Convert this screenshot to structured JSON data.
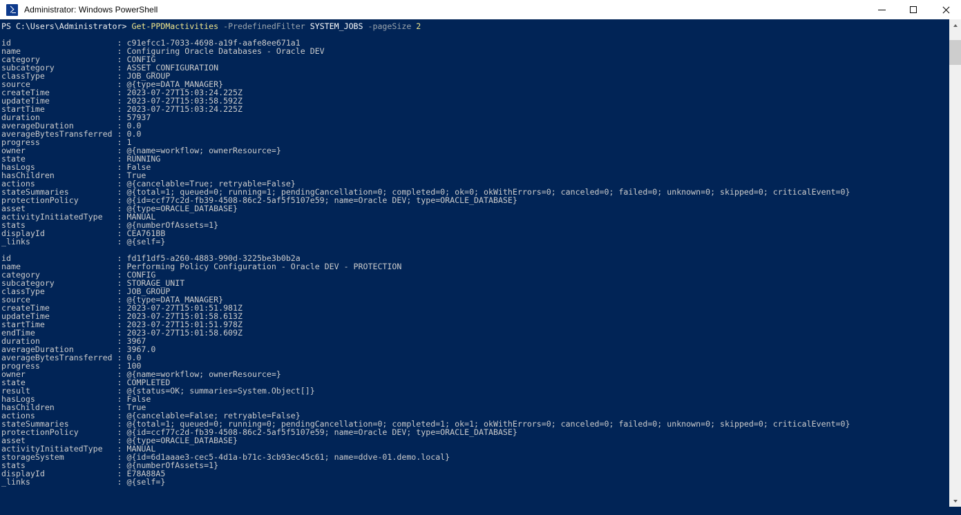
{
  "window": {
    "title": "Administrator: Windows PowerShell",
    "icon": "powershell-icon",
    "titlebar_bg": "#ffffff",
    "console_bg": "#012456",
    "console_fg": "#cccccc",
    "controls": {
      "minimize": "minimize-button",
      "maximize": "maximize-button",
      "close": "close-button"
    }
  },
  "scrollbar": {
    "up_arrow": "scroll-up-arrow",
    "down_arrow": "scroll-down-arrow",
    "thumb": "scrollbar-thumb"
  },
  "console": {
    "prompt": "PS C:\\Users\\Administrator> ",
    "command": {
      "cmdlet": "Get-PPDMactivities",
      "params": [
        {
          "flag": "-PredefinedFilter",
          "value": "SYSTEM_JOBS",
          "value_type": "string"
        },
        {
          "flag": "-pageSize",
          "value": "2",
          "value_type": "number"
        }
      ],
      "full_text": "Get-PPDMactivities -PredefinedFilter SYSTEM_JOBS -pageSize 2"
    },
    "colors": {
      "cmdlet": "#f0e68c",
      "parameter": "#9aa4ad",
      "argument": "#ffffff",
      "number": "#f0e68c",
      "output": "#cccccc"
    },
    "label_width": 24,
    "records": [
      {
        "fields": [
          {
            "key": "id",
            "value": "c91efcc1-7033-4698-a19f-aafe8ee671a1"
          },
          {
            "key": "name",
            "value": "Configuring Oracle Databases - Oracle DEV"
          },
          {
            "key": "category",
            "value": "CONFIG"
          },
          {
            "key": "subcategory",
            "value": "ASSET_CONFIGURATION"
          },
          {
            "key": "classType",
            "value": "JOB_GROUP"
          },
          {
            "key": "source",
            "value": "@{type=DATA_MANAGER}"
          },
          {
            "key": "createTime",
            "value": "2023-07-27T15:03:24.225Z"
          },
          {
            "key": "updateTime",
            "value": "2023-07-27T15:03:58.592Z"
          },
          {
            "key": "startTime",
            "value": "2023-07-27T15:03:24.225Z"
          },
          {
            "key": "duration",
            "value": "57937"
          },
          {
            "key": "averageDuration",
            "value": "0.0"
          },
          {
            "key": "averageBytesTransferred",
            "value": "0.0"
          },
          {
            "key": "progress",
            "value": "1"
          },
          {
            "key": "owner",
            "value": "@{name=workflow; ownerResource=}"
          },
          {
            "key": "state",
            "value": "RUNNING"
          },
          {
            "key": "hasLogs",
            "value": "False"
          },
          {
            "key": "hasChildren",
            "value": "True"
          },
          {
            "key": "actions",
            "value": "@{cancelable=True; retryable=False}"
          },
          {
            "key": "stateSummaries",
            "value": "@{total=1; queued=0; running=1; pendingCancellation=0; completed=0; ok=0; okWithErrors=0; canceled=0; failed=0; unknown=0; skipped=0; criticalEvent=0}"
          },
          {
            "key": "protectionPolicy",
            "value": "@{id=ccf77c2d-fb39-4508-86c2-5af5f5107e59; name=Oracle DEV; type=ORACLE_DATABASE}"
          },
          {
            "key": "asset",
            "value": "@{type=ORACLE_DATABASE}"
          },
          {
            "key": "activityInitiatedType",
            "value": "MANUAL"
          },
          {
            "key": "stats",
            "value": "@{numberOfAssets=1}"
          },
          {
            "key": "displayId",
            "value": "CEA761BB"
          },
          {
            "key": "_links",
            "value": "@{self=}"
          }
        ]
      },
      {
        "fields": [
          {
            "key": "id",
            "value": "fd1f1df5-a260-4883-990d-3225be3b0b2a"
          },
          {
            "key": "name",
            "value": "Performing Policy Configuration - Oracle DEV - PROTECTION"
          },
          {
            "key": "category",
            "value": "CONFIG"
          },
          {
            "key": "subcategory",
            "value": "STORAGE_UNIT"
          },
          {
            "key": "classType",
            "value": "JOB_GROUP"
          },
          {
            "key": "source",
            "value": "@{type=DATA_MANAGER}"
          },
          {
            "key": "createTime",
            "value": "2023-07-27T15:01:51.981Z"
          },
          {
            "key": "updateTime",
            "value": "2023-07-27T15:01:58.613Z"
          },
          {
            "key": "startTime",
            "value": "2023-07-27T15:01:51.978Z"
          },
          {
            "key": "endTime",
            "value": "2023-07-27T15:01:58.609Z"
          },
          {
            "key": "duration",
            "value": "3967"
          },
          {
            "key": "averageDuration",
            "value": "3967.0"
          },
          {
            "key": "averageBytesTransferred",
            "value": "0.0"
          },
          {
            "key": "progress",
            "value": "100"
          },
          {
            "key": "owner",
            "value": "@{name=workflow; ownerResource=}"
          },
          {
            "key": "state",
            "value": "COMPLETED"
          },
          {
            "key": "result",
            "value": "@{status=OK; summaries=System.Object[]}"
          },
          {
            "key": "hasLogs",
            "value": "False"
          },
          {
            "key": "hasChildren",
            "value": "True"
          },
          {
            "key": "actions",
            "value": "@{cancelable=False; retryable=False}"
          },
          {
            "key": "stateSummaries",
            "value": "@{total=1; queued=0; running=0; pendingCancellation=0; completed=1; ok=1; okWithErrors=0; canceled=0; failed=0; unknown=0; skipped=0; criticalEvent=0}"
          },
          {
            "key": "protectionPolicy",
            "value": "@{id=ccf77c2d-fb39-4508-86c2-5af5f5107e59; name=Oracle DEV; type=ORACLE_DATABASE}"
          },
          {
            "key": "asset",
            "value": "@{type=ORACLE_DATABASE}"
          },
          {
            "key": "activityInitiatedType",
            "value": "MANUAL"
          },
          {
            "key": "storageSystem",
            "value": "@{id=6d1aaae3-cec5-4d1a-b71c-3cb93ec45c61; name=ddve-01.demo.local}"
          },
          {
            "key": "stats",
            "value": "@{numberOfAssets=1}"
          },
          {
            "key": "displayId",
            "value": "E78A88A5"
          },
          {
            "key": "_links",
            "value": "@{self=}"
          }
        ]
      }
    ]
  }
}
